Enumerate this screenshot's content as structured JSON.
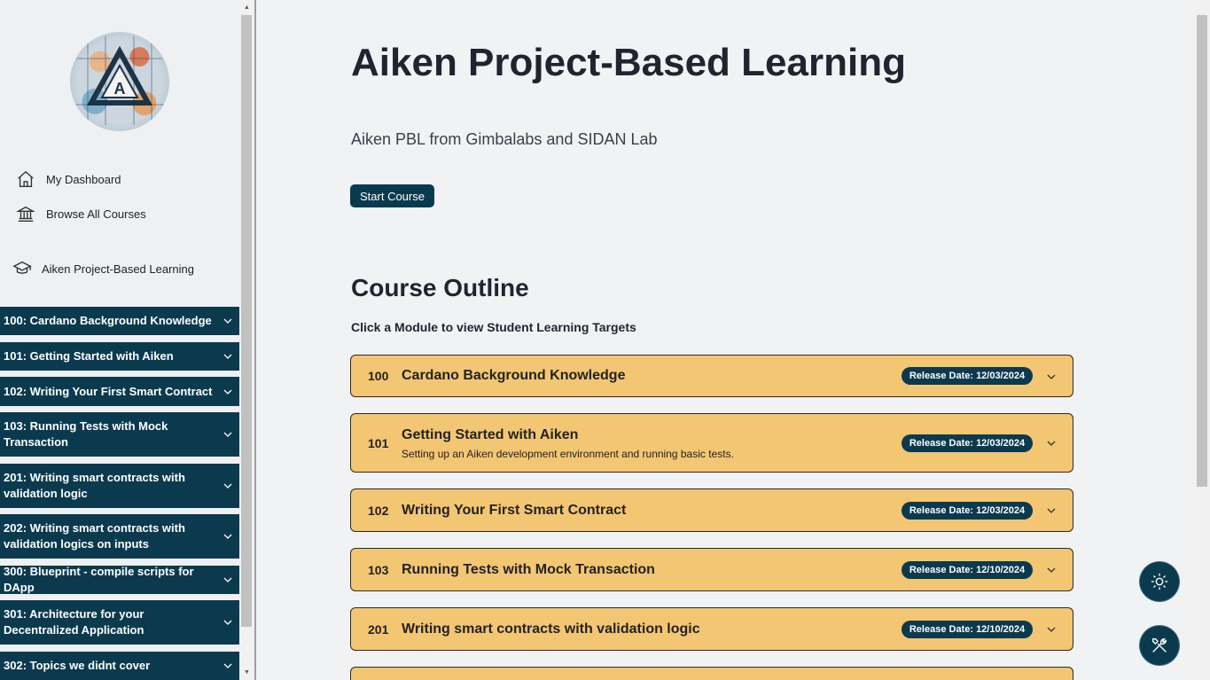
{
  "sidebar": {
    "nav": [
      {
        "label": "My Dashboard",
        "icon": "home-icon"
      },
      {
        "label": "Browse All Courses",
        "icon": "bank-icon"
      }
    ],
    "course_link": {
      "label": "Aiken Project-Based Learning",
      "icon": "graduation-cap-icon"
    },
    "modules": [
      {
        "label": "100: Cardano Background Knowledge"
      },
      {
        "label": "101: Getting Started with Aiken"
      },
      {
        "label": "102: Writing Your First Smart Contract"
      },
      {
        "label": "103: Running Tests with Mock Transaction"
      },
      {
        "label": "201: Writing smart contracts with validation logic"
      },
      {
        "label": "202: Writing smart contracts with validation logics on inputs"
      },
      {
        "label": "300: Blueprint - compile scripts for DApp"
      },
      {
        "label": "301: Architecture for your Decentralized Application"
      },
      {
        "label": "302: Topics we didnt cover"
      }
    ]
  },
  "main": {
    "title": "Aiken Project-Based Learning",
    "subtitle": "Aiken PBL from Gimbalabs and SIDAN Lab",
    "start_button": "Start Course",
    "outline_heading": "Course Outline",
    "outline_subheading": "Click a Module to view Student Learning Targets",
    "modules": [
      {
        "number": "100",
        "title": "Cardano Background Knowledge",
        "description": "",
        "release": "Release Date: 12/03/2024"
      },
      {
        "number": "101",
        "title": "Getting Started with Aiken",
        "description": "Setting up an Aiken development environment and running basic tests.",
        "release": "Release Date: 12/03/2024"
      },
      {
        "number": "102",
        "title": "Writing Your First Smart Contract",
        "description": "",
        "release": "Release Date: 12/03/2024"
      },
      {
        "number": "103",
        "title": "Running Tests with Mock Transaction",
        "description": "",
        "release": "Release Date: 12/10/2024"
      },
      {
        "number": "201",
        "title": "Writing smart contracts with validation logic",
        "description": "",
        "release": "Release Date: 12/10/2024"
      }
    ]
  },
  "fabs": [
    {
      "icon": "sun-icon"
    },
    {
      "icon": "tools-icon"
    }
  ],
  "colors": {
    "navy": "#0b3a4e",
    "card": "#f3c673",
    "background": "#f1f2f4"
  }
}
